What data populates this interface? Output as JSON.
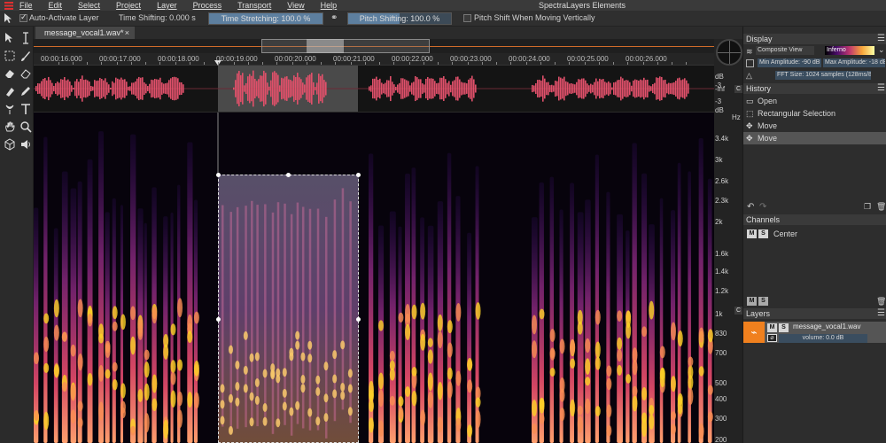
{
  "app": {
    "title": "SpectraLayers Elements",
    "menu": [
      "File",
      "Edit",
      "Select",
      "Project",
      "Layer",
      "Process",
      "Transport",
      "View",
      "Help"
    ]
  },
  "options_bar": {
    "auto_activate_label": "Auto-Activate Layer",
    "auto_activate_checked": true,
    "time_shifting": "Time Shifting: 0.000 s",
    "time_stretching": "Time Stretching: 100.0 %",
    "time_stretching_level": 1.0,
    "pitch_shifting": "Pitch Shifting: 100.0 %",
    "pitch_shifting_level": 0.5,
    "pitch_shift_vertical_label": "Pitch Shift When Moving Vertically",
    "pitch_shift_vertical_checked": false
  },
  "document": {
    "tab_label": "message_vocal1.wav*",
    "close_glyph": "×"
  },
  "ruler": {
    "labels": [
      "00:00:16.000",
      "00:00:17.000",
      "00:00:18.000",
      "00:00:19.000",
      "00:00:20.000",
      "00:00:21.000",
      "00:00:22.000",
      "00:00:23.000",
      "00:00:24.000",
      "00:00:25.000",
      "00:00:26.000"
    ]
  },
  "amplitude_scale": {
    "labels": [
      "dB",
      "-3",
      "-inf",
      "-3",
      "dB"
    ],
    "c_label": "C"
  },
  "frequency_scale": {
    "unit": "Hz",
    "labels": [
      "3.4k",
      "3k",
      "2.6k",
      "2.3k",
      "2k",
      "1.6k",
      "1.4k",
      "1.2k",
      "1k",
      "830",
      "700",
      "500",
      "400",
      "300",
      "200"
    ],
    "c_label": "C"
  },
  "display_panel": {
    "header": "Display",
    "view_mode": "Composite View",
    "colormap": "Inferno",
    "min_amplitude": "Min Amplitude: -90 dB",
    "max_amplitude": "Max Amplitude: -18 dB",
    "fft_size": "FFT Size: 1024 samples (128ms/8Hz)"
  },
  "history_panel": {
    "header": "History",
    "items": [
      {
        "label": "Open",
        "icon": "folder-icon",
        "active": false
      },
      {
        "label": "Rectangular Selection",
        "icon": "rect-select-icon",
        "active": false
      },
      {
        "label": "Move",
        "icon": "move-icon",
        "active": false
      },
      {
        "label": "Move",
        "icon": "move-icon",
        "active": true
      }
    ]
  },
  "channels_panel": {
    "header": "Channels",
    "channel_name": "Center",
    "m_label": "M",
    "s_label": "S"
  },
  "layers_panel": {
    "header": "Layers",
    "layer_name": "message_vocal1.wav",
    "volume": "volume: 0.0 dB",
    "m_label": "M",
    "s_label": "S"
  },
  "colors": {
    "accent_orange": "#f0801e",
    "waveform": "#e0506a",
    "selection_blue": "#5d7f9f"
  }
}
